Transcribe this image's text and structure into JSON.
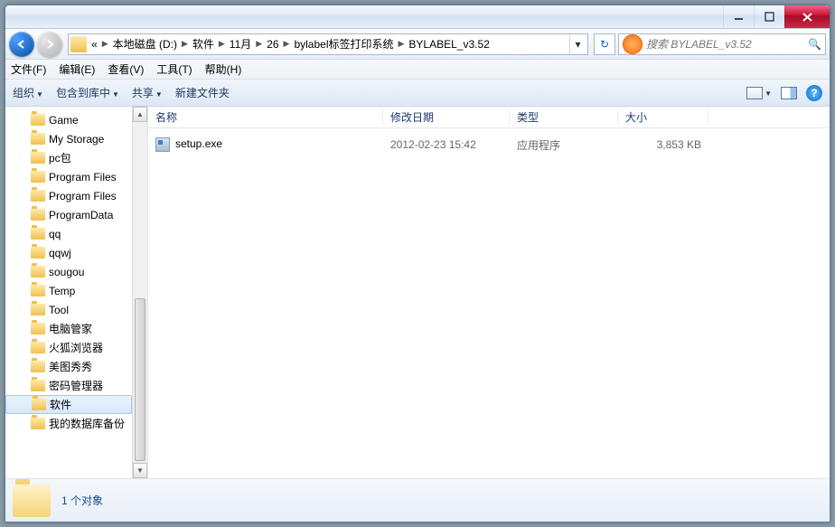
{
  "breadcrumb": {
    "prefix": "«",
    "segments": [
      "本地磁盘 (D:)",
      "软件",
      "11月",
      "26",
      "bylabel标签打印系统",
      "BYLABEL_v3.52"
    ]
  },
  "search": {
    "placeholder": "搜索 BYLABEL_v3.52"
  },
  "menu": {
    "file": "文件(F)",
    "edit": "编辑(E)",
    "view": "查看(V)",
    "tools": "工具(T)",
    "help": "帮助(H)"
  },
  "toolbar": {
    "organize": "组织",
    "include": "包含到库中",
    "share": "共享",
    "new_folder": "新建文件夹"
  },
  "columns": {
    "name": "名称",
    "date": "修改日期",
    "type": "类型",
    "size": "大小"
  },
  "tree": [
    "Game",
    "My Storage",
    "pc包",
    "Program Files",
    "Program Files",
    "ProgramData",
    "qq",
    "qqwj",
    "sougou",
    "Temp",
    "Tool",
    "电脑管家",
    "火狐浏览器",
    "美图秀秀",
    "密码管理器",
    "软件",
    "我的数据库备份"
  ],
  "tree_selected_index": 15,
  "files": [
    {
      "name": "setup.exe",
      "date": "2012-02-23 15:42",
      "type": "应用程序",
      "size": "3,853 KB"
    }
  ],
  "status": {
    "count": "1 个对象"
  }
}
